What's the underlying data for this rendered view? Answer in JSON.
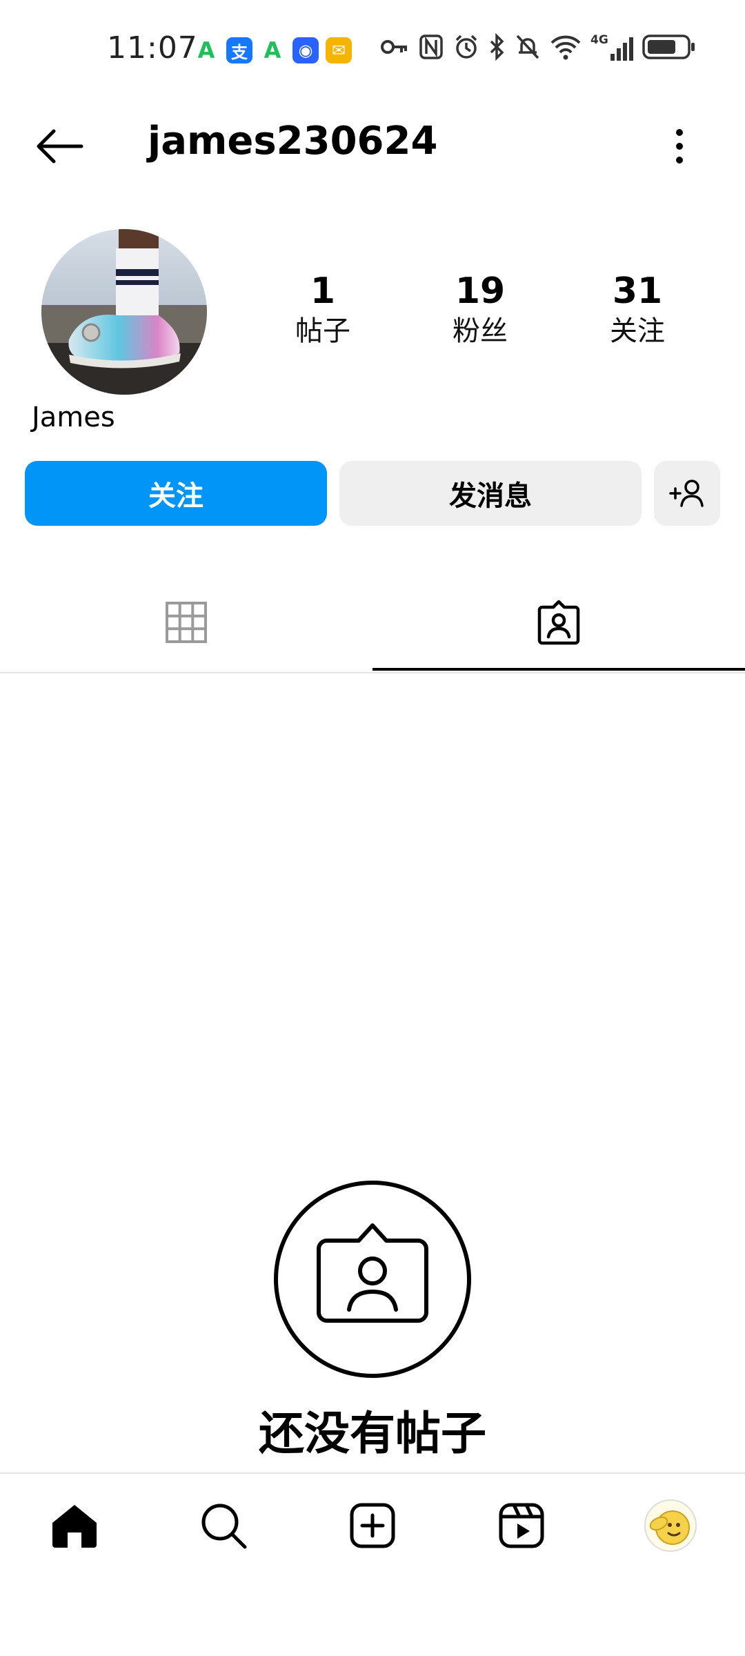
{
  "status_bar": {
    "time": "11:07",
    "app_icons": [
      "app-a-icon",
      "alipay-icon",
      "app-a-icon",
      "security-app-icon",
      "mail-app-icon"
    ],
    "app_badges": [
      "A",
      "支",
      "A",
      "◉",
      "✉"
    ],
    "system_icons": [
      "key-icon",
      "nfc-icon",
      "alarm-icon",
      "bluetooth-icon",
      "mute-icon",
      "wifi-icon",
      "signal-4g-icon",
      "battery-icon"
    ],
    "network_label": "4G"
  },
  "header": {
    "title": "james230624"
  },
  "profile": {
    "display_name": "James",
    "stats": [
      {
        "value": "1",
        "label": "帖子"
      },
      {
        "value": "19",
        "label": "粉丝"
      },
      {
        "value": "31",
        "label": "关注"
      }
    ]
  },
  "actions": {
    "follow": "关注",
    "message": "发消息"
  },
  "tabs": [
    {
      "name": "posts-grid",
      "icon": "grid-icon",
      "active": false
    },
    {
      "name": "tagged",
      "icon": "tagged-person-icon",
      "active": true
    }
  ],
  "empty_state": {
    "title": "还没有帖子"
  },
  "bottom_nav": [
    "home-icon",
    "search-icon",
    "create-icon",
    "reels-icon",
    "profile-avatar"
  ],
  "colors": {
    "accent": "#0095f6",
    "secondary_button": "#efefef"
  }
}
